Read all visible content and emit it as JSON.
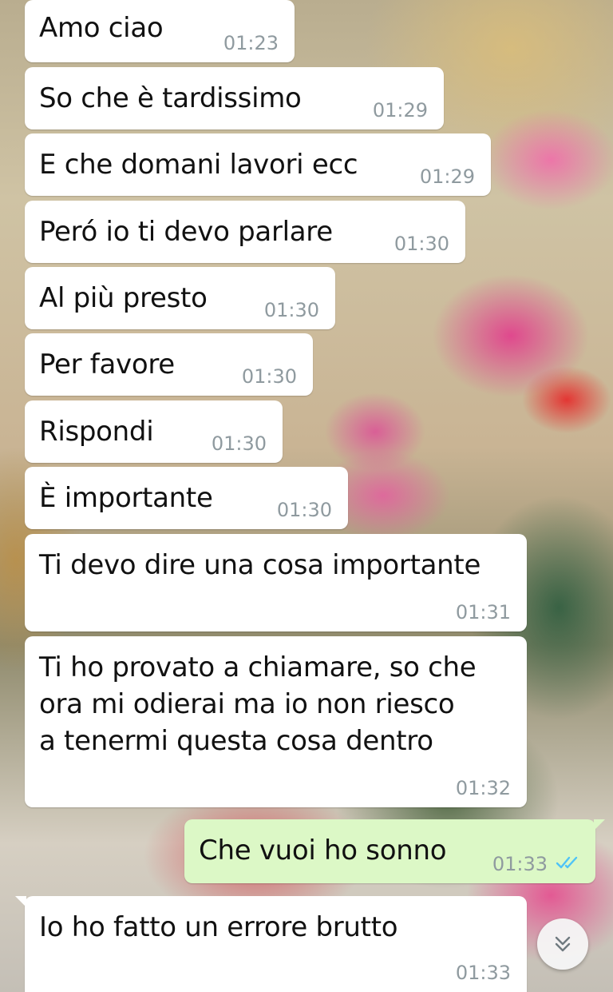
{
  "messages": [
    {
      "direction": "incoming",
      "text": "Amo ciao",
      "time": "01:23"
    },
    {
      "direction": "incoming",
      "text": "So che è tardissimo",
      "time": "01:29"
    },
    {
      "direction": "incoming",
      "text": "E che domani lavori ecc",
      "time": "01:29"
    },
    {
      "direction": "incoming",
      "text": "Peró io ti devo parlare",
      "time": "01:30"
    },
    {
      "direction": "incoming",
      "text": "Al più presto",
      "time": "01:30"
    },
    {
      "direction": "incoming",
      "text": "Per favore",
      "time": "01:30"
    },
    {
      "direction": "incoming",
      "text": "Rispondi",
      "time": "01:30"
    },
    {
      "direction": "incoming",
      "text": "È importante",
      "time": "01:30"
    },
    {
      "direction": "incoming",
      "text": "Ti devo dire una cosa importante",
      "time": "01:31"
    },
    {
      "direction": "incoming",
      "text": "Ti ho provato a chiamare, so che\nora mi odierai ma io non riesco\na tenermi questa cosa dentro",
      "time": "01:32"
    },
    {
      "direction": "outgoing",
      "text": "Che vuoi ho sonno",
      "time": "01:33",
      "status": "read",
      "status_icon": "double-check-icon",
      "status_color": "#4fc3f7"
    },
    {
      "direction": "incoming",
      "text": "Io ho fatto un errore brutto",
      "time": "01:33"
    }
  ],
  "scroll_button": {
    "icon": "double-chevron-down-icon"
  },
  "colors": {
    "incoming_bubble": "#ffffff",
    "outgoing_bubble": "#dcf8c6",
    "timestamp": "#8f9a9f",
    "read_ticks": "#4fc3f7"
  }
}
